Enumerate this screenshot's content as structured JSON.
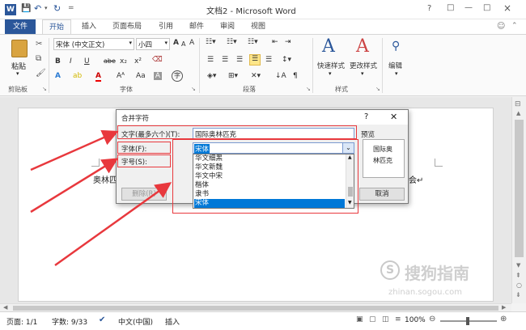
{
  "window": {
    "title": "文档2 - Microsoft Word",
    "controls": [
      "?",
      "□",
      "—",
      "□",
      "×"
    ]
  },
  "qat": {
    "save": "💾",
    "undo": "↶",
    "redo": "↻",
    "customize": "="
  },
  "tabs": {
    "file": "文件",
    "home": "开始",
    "insert": "插入",
    "layout": "页面布局",
    "references": "引用",
    "mailings": "邮件",
    "review": "审阅",
    "view": "视图"
  },
  "ribbon": {
    "paste": "粘贴",
    "font_name": "宋体 (中文正文)",
    "font_size": "小四",
    "groups": {
      "clipboard": "剪贴板",
      "font": "字体",
      "paragraph": "段落",
      "styles": "样式",
      "editing": "编辑"
    },
    "quick_styles": "快速样式",
    "change_styles": "更改样式",
    "editing_btn": "编辑",
    "font_buttons": [
      "B",
      "I",
      "U",
      "abe",
      "x₂",
      "x²",
      "A",
      "A",
      "A",
      "Aᴬ",
      "A",
      "字"
    ],
    "para_buttons": [
      "☰",
      "☰",
      "☰",
      "☰",
      "☰",
      "☰",
      "☰",
      "↕",
      "A↓",
      "¶"
    ]
  },
  "dialog": {
    "title": "合并字符",
    "help": "?",
    "close": "✕",
    "text_label": "文字(最多六个)(T):",
    "text_value": "国际奥林匹克",
    "font_label": "字体(F):",
    "font_value": "宋体",
    "size_label": "字号(S):",
    "font_list": [
      "华文细黑",
      "华文新魏",
      "华文中宋",
      "楷体",
      "隶书",
      "宋体"
    ],
    "selected_index": 5,
    "preview_label": "预览",
    "preview_text": [
      "国际奥",
      "林匹克"
    ],
    "remove_button": "删除(R)",
    "cancel_button": "取消"
  },
  "document": {
    "left_text": "奥林匹",
    "right_text": "会↵"
  },
  "statusbar": {
    "page": "页面: 1/1",
    "words": "字数: 9/33",
    "language": "中文(中国)",
    "mode": "插入",
    "zoom": "100%"
  },
  "watermark": {
    "main": "搜狗指南",
    "sub": "zhinan.sogou.com"
  },
  "colors": {
    "accent": "#2b579a",
    "red": "#e8383d",
    "selection": "#0078d7"
  }
}
